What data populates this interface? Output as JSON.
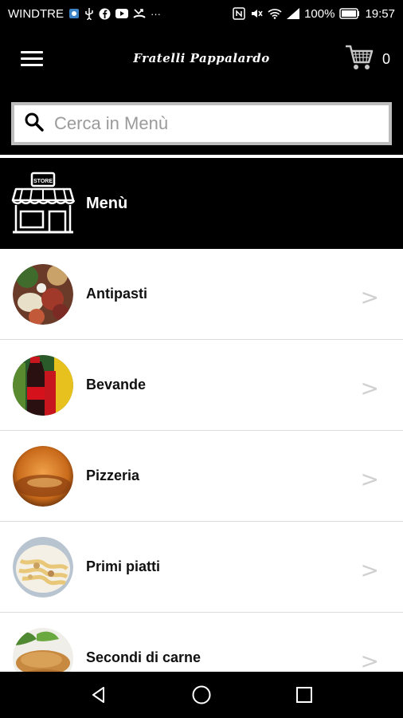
{
  "status_bar": {
    "carrier": "WINDTRE",
    "battery": "100%",
    "time": "19:57"
  },
  "header": {
    "logo_text": "Fratelli Pappalardo",
    "cart_count": "0"
  },
  "search": {
    "placeholder": "Cerca in Menù"
  },
  "menu": {
    "title": "Menù",
    "store_sign": "STORE"
  },
  "categories": [
    {
      "label": "Antipasti",
      "chevron": ">"
    },
    {
      "label": "Bevande",
      "chevron": ">"
    },
    {
      "label": "Pizzeria",
      "chevron": ">"
    },
    {
      "label": "Primi piatti",
      "chevron": ">"
    },
    {
      "label": "Secondi di carne",
      "chevron": ">"
    }
  ],
  "colors": {
    "background": "#000000",
    "list_background": "#ffffff",
    "chevron": "#d0d0d0",
    "search_border": "#bdbdbd"
  },
  "icons": [
    "hamburger-icon",
    "cart-icon",
    "search-icon",
    "store-icon",
    "back-icon",
    "home-icon",
    "recents-icon"
  ]
}
